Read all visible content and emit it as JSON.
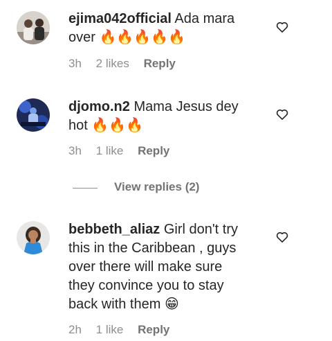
{
  "comments": [
    {
      "username": "ejima042official",
      "text_lines": [
        "Ada mara",
        "over 🔥🔥🔥🔥🔥"
      ],
      "time": "3h",
      "likes": "2 likes",
      "reply_label": "Reply"
    },
    {
      "username": "djomo.n2",
      "text_lines": [
        "Mama Jesus dey",
        "hot 🔥🔥🔥"
      ],
      "time": "3h",
      "likes": "1 like",
      "reply_label": "Reply"
    },
    {
      "username": "bebbeth_aliaz",
      "text_lines": [
        "Girl don't try",
        "this in the Caribbean , guys",
        "over there will make sure",
        "they convince you to stay",
        "back with them 😁"
      ],
      "time": "2h",
      "likes": "1 like",
      "reply_label": "Reply"
    }
  ],
  "view_replies": "View replies (2)",
  "icons": {
    "like": "heart-outline-icon"
  }
}
